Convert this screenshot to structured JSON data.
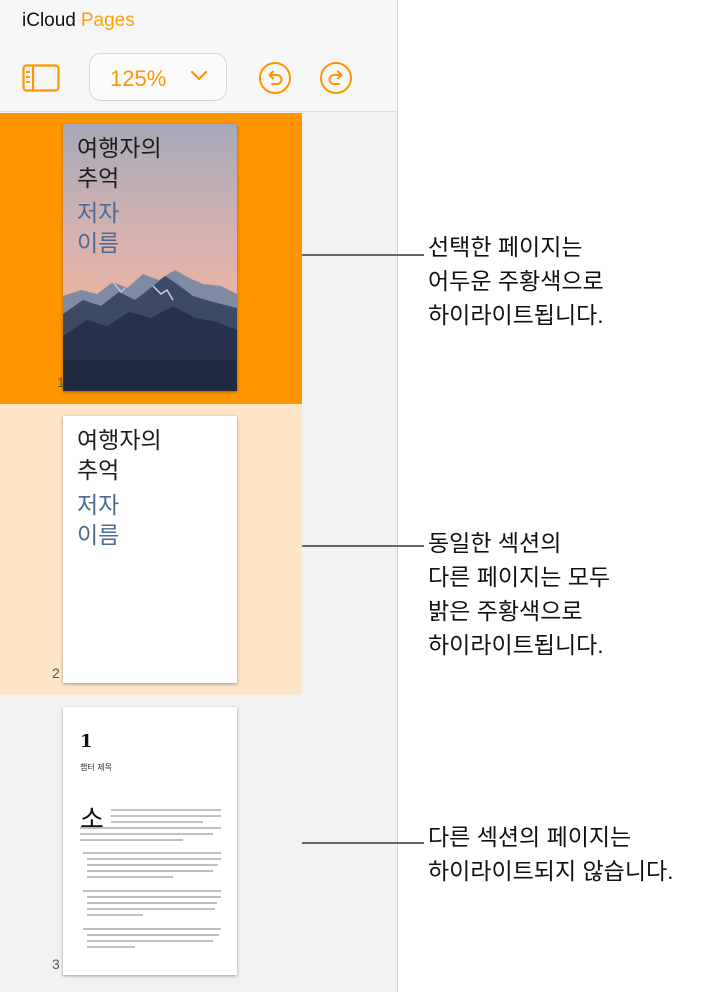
{
  "header": {
    "brand_icloud": "iCloud",
    "brand_pages": "Pages",
    "zoom_value": "125%",
    "icons": {
      "sidebar_toggle": "sidebar-icon",
      "undo": "undo-icon",
      "redo": "redo-icon",
      "zoom_menu": "chevron-down-icon"
    }
  },
  "colors": {
    "accent": "#ff9500",
    "selected_page": "#ff9500",
    "same_section": "#fde5c8"
  },
  "pages": [
    {
      "number": "1",
      "title": "여행자의\n추억",
      "author": "저자\n이름"
    },
    {
      "number": "2",
      "title": "여행자의\n추억",
      "author": "저자\n이름"
    },
    {
      "number": "3",
      "chapter_number": "1",
      "chapter_title": "챕터 제목",
      "drop_cap": "소"
    }
  ],
  "callouts": [
    "선택한 페이지는\n어두운 주황색으로\n하이라이트됩니다.",
    "동일한 섹션의\n다른 페이지는 모두\n밝은 주황색으로\n하이라이트됩니다.",
    "다른 섹션의 페이지는\n하이라이트되지 않습니다."
  ]
}
